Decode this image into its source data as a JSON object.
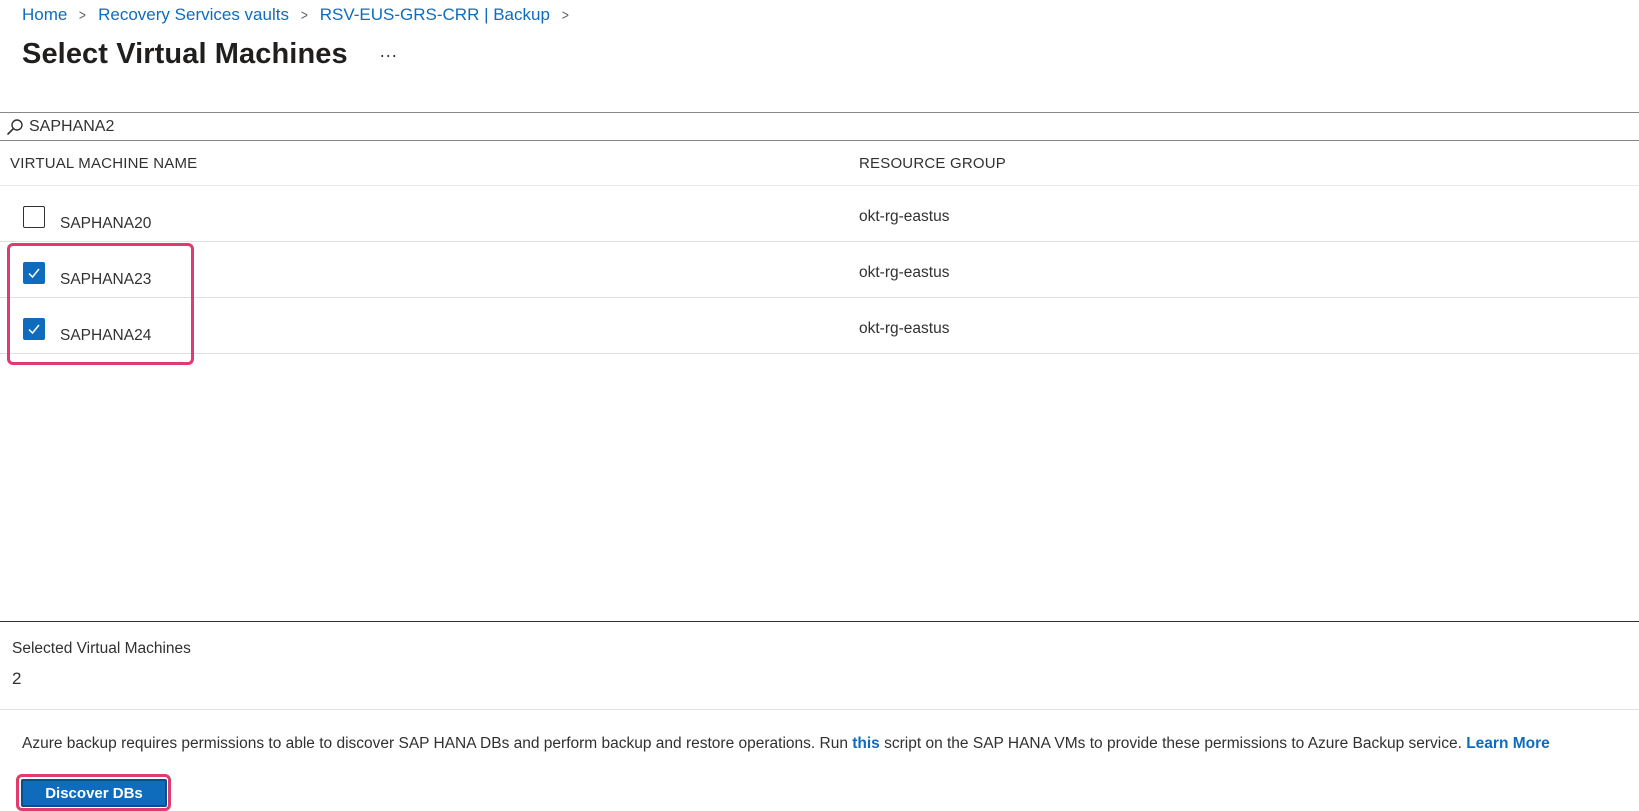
{
  "breadcrumb": {
    "items": [
      "Home",
      "Recovery Services vaults",
      "RSV-EUS-GRS-CRR | Backup"
    ]
  },
  "page": {
    "title": "Select Virtual Machines",
    "more_label": "..."
  },
  "search": {
    "value": "SAPHANA2",
    "icon": "search-icon"
  },
  "table": {
    "columns": [
      "VIRTUAL MACHINE NAME",
      "RESOURCE GROUP"
    ],
    "rows": [
      {
        "name": "SAPHANA20",
        "resource_group": "okt-rg-eastus",
        "checked": false
      },
      {
        "name": "SAPHANA23",
        "resource_group": "okt-rg-eastus",
        "checked": true
      },
      {
        "name": "SAPHANA24",
        "resource_group": "okt-rg-eastus",
        "checked": true
      }
    ]
  },
  "selection": {
    "label": "Selected Virtual Machines",
    "count": "2"
  },
  "note": {
    "text_before": "Azure backup requires permissions to able to discover SAP HANA DBs and perform backup and restore operations. Run ",
    "link_this": "this",
    "text_after": " script on the SAP HANA VMs to provide these permissions to Azure Backup service. ",
    "link_learn_more": "Learn More"
  },
  "actions": {
    "discover_label": "Discover DBs"
  },
  "colors": {
    "accent": "#0f6cbd",
    "highlight": "#e03a6e"
  }
}
